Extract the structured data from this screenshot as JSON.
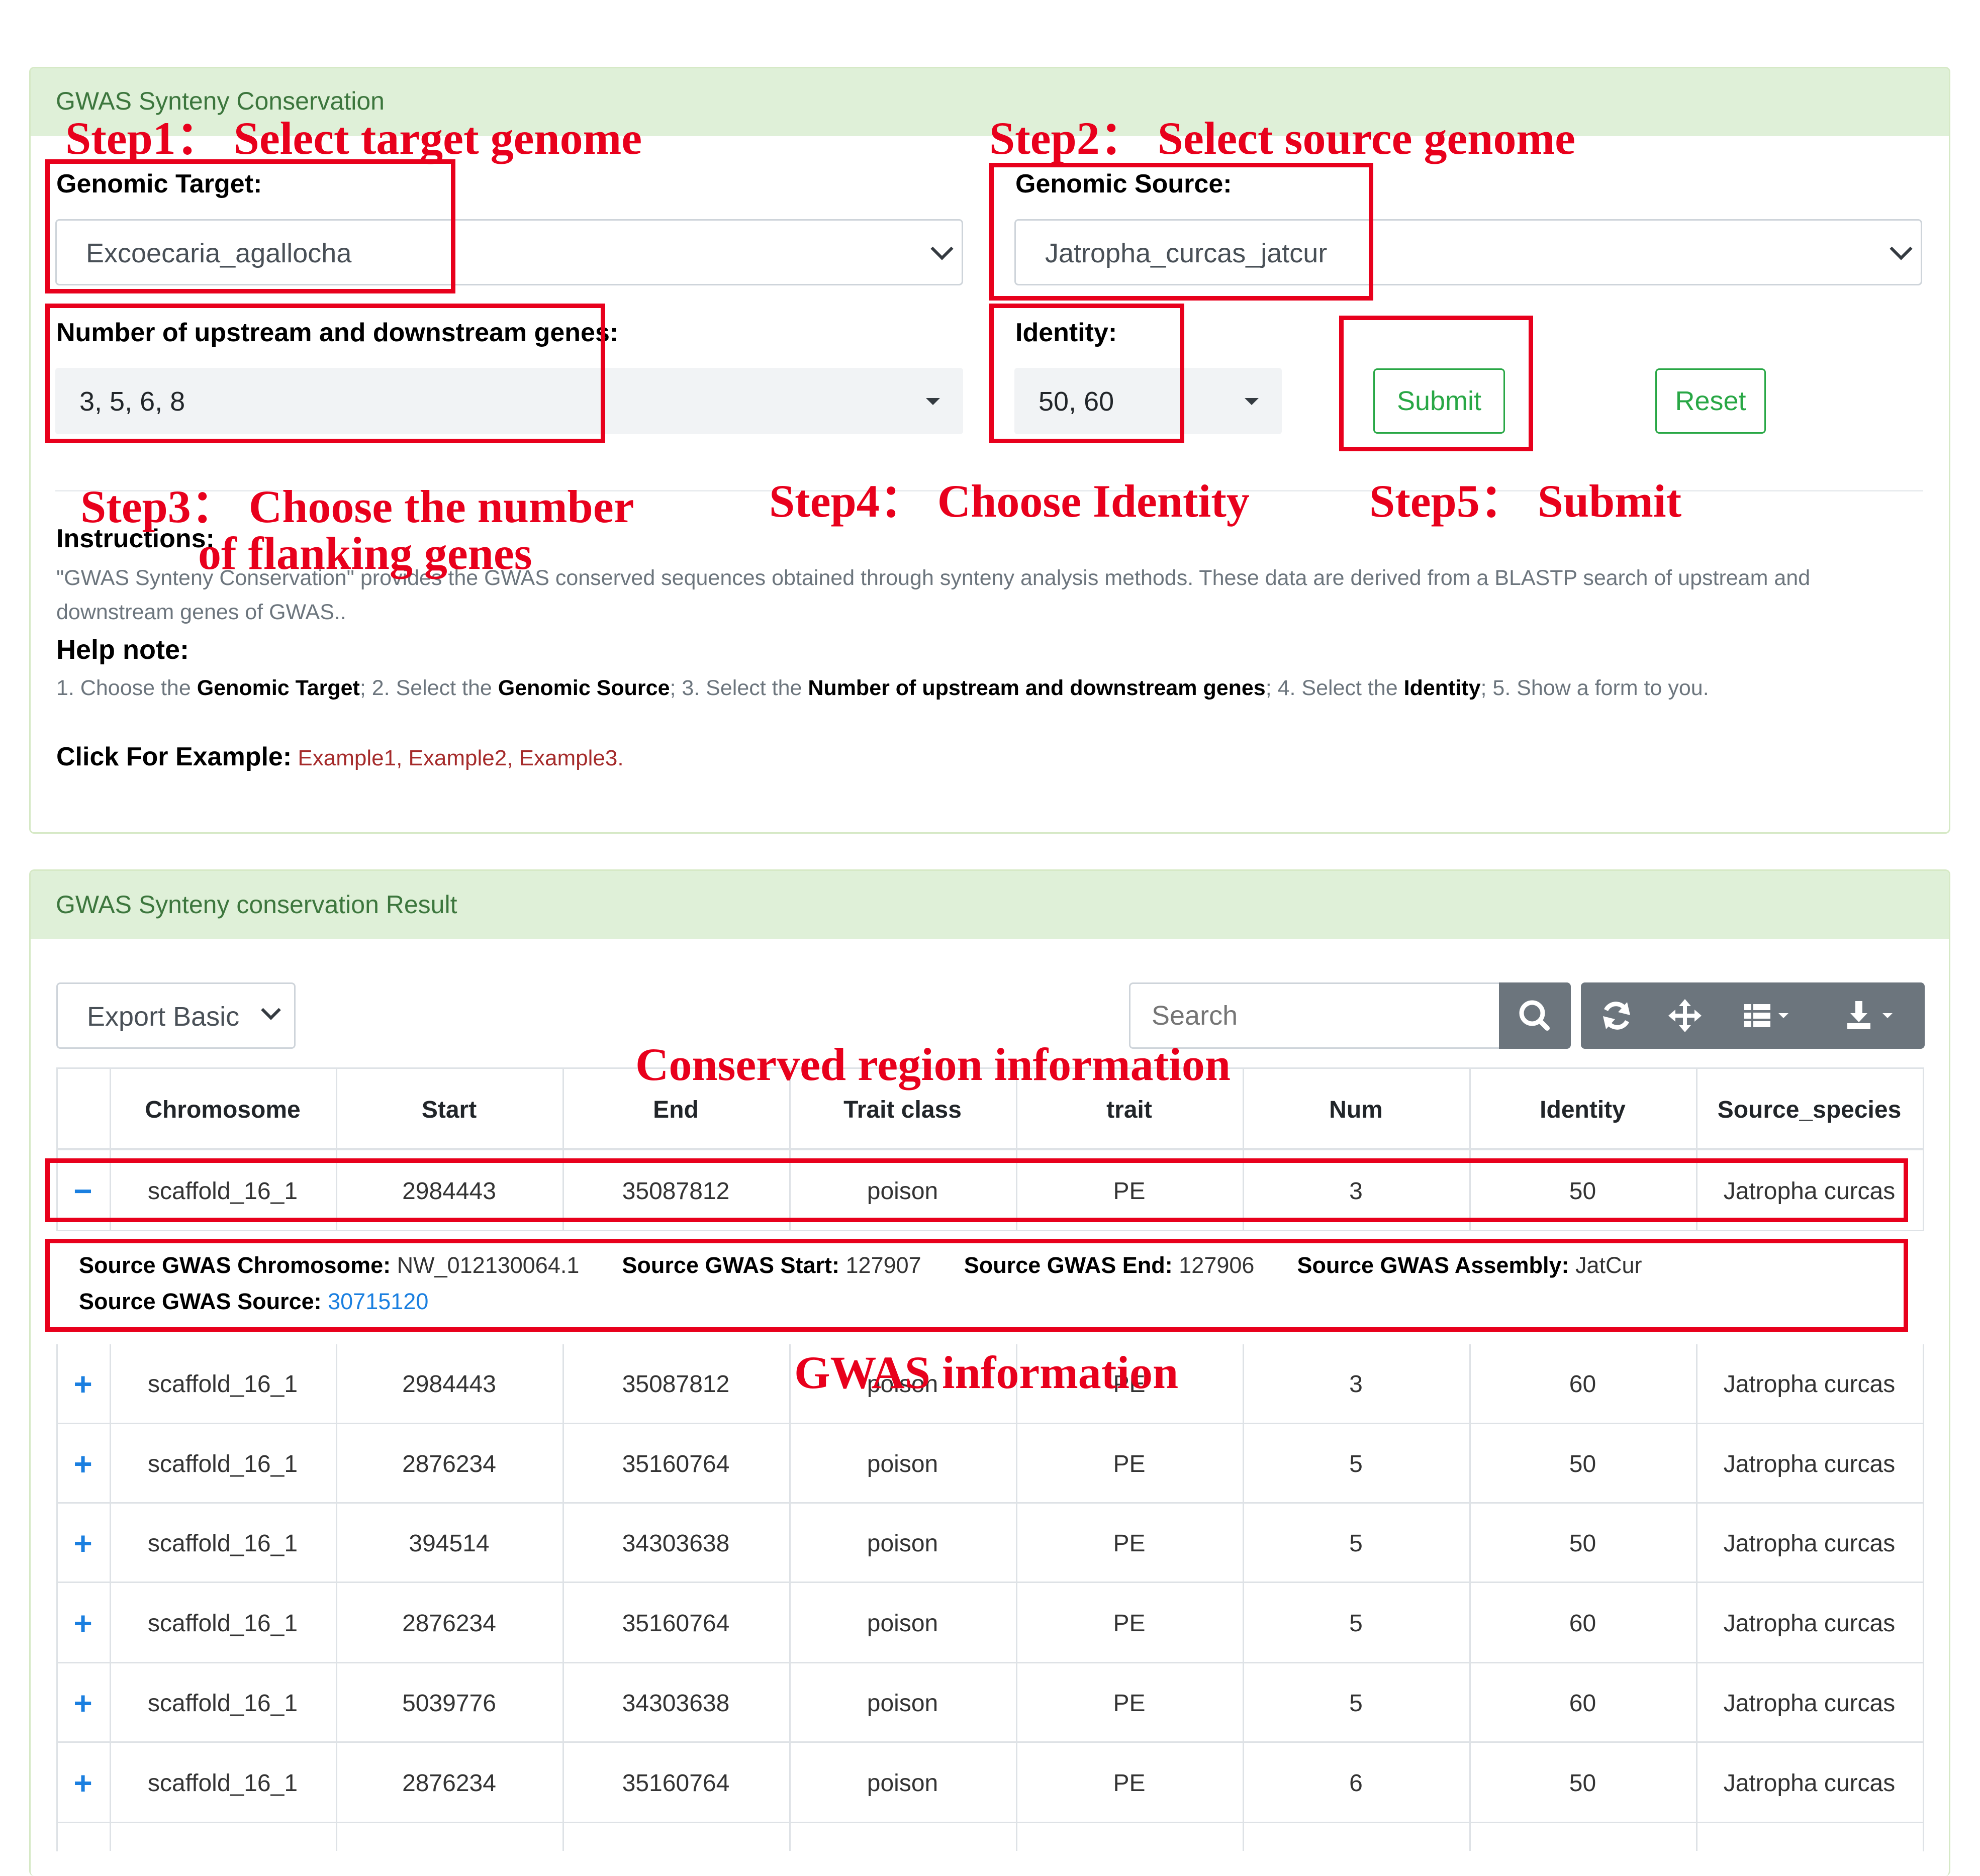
{
  "form_card": {
    "title": "GWAS Synteny Conservation",
    "genomic_target": {
      "label": "Genomic Target:",
      "value": "Excoecaria_agallocha"
    },
    "genomic_source": {
      "label": "Genomic Source:",
      "value": "Jatropha_curcas_jatcur"
    },
    "flanking": {
      "label": "Number of upstream and downstream genes:",
      "value": "3, 5, 6, 8"
    },
    "identity": {
      "label": "Identity:",
      "value": "50, 60"
    },
    "submit_label": "Submit",
    "reset_label": "Reset",
    "instructions_title": "Instructions:",
    "instructions_text_1": "\"GWAS Synteny Conservation\" provides the GWAS conserved sequences obtained through synteny analysis methods. These data are derived from a BLASTP search of upstream and",
    "instructions_text_2": "downstream genes of GWAS..",
    "help_title": "Help note:",
    "help_parts": [
      "1. Choose the ",
      "Genomic Target",
      "; 2. Select the ",
      "Genomic Source",
      "; 3. Select the ",
      "Number of upstream and downstream genes",
      "; 4. Select the ",
      "Identity",
      "; 5. Show a form to you."
    ],
    "example_label": "Click For Example:",
    "examples": [
      "Example1",
      "Example2",
      "Example3"
    ],
    "example_sep": ", ",
    "example_end": "."
  },
  "annotations": {
    "step1": "Step1： Select target genome",
    "step2": "Step2： Select source genome",
    "step3_line1": "Step3： Choose the number",
    "step3_line2": "of flanking genes",
    "step4": "Step4： Choose Identity",
    "step5": "Step5： Submit",
    "conserved": "Conserved region information",
    "gwas": "GWAS information"
  },
  "result_card": {
    "title": "GWAS Synteny conservation Result",
    "export_value": "Export Basic",
    "search_placeholder": "Search",
    "toolbar_icons": [
      "search-icon",
      "refresh-icon",
      "move-icon",
      "columns-icon",
      "download-icon"
    ],
    "columns": [
      "Chromosome",
      "Start",
      "End",
      "Trait class",
      "trait",
      "Num",
      "Identity",
      "Source_species"
    ],
    "rows": [
      {
        "toggle": "−",
        "chromosome": "scaffold_16_1",
        "start": "2984443",
        "end": "35087812",
        "trait_class": "poison",
        "trait": "PE",
        "num": "3",
        "identity": "50",
        "species": "Jatropha curcas"
      },
      {
        "toggle": "+",
        "chromosome": "scaffold_16_1",
        "start": "2984443",
        "end": "35087812",
        "trait_class": "poison",
        "trait": "PE",
        "num": "3",
        "identity": "60",
        "species": "Jatropha curcas"
      },
      {
        "toggle": "+",
        "chromosome": "scaffold_16_1",
        "start": "2876234",
        "end": "35160764",
        "trait_class": "poison",
        "trait": "PE",
        "num": "5",
        "identity": "50",
        "species": "Jatropha curcas"
      },
      {
        "toggle": "+",
        "chromosome": "scaffold_16_1",
        "start": "394514",
        "end": "34303638",
        "trait_class": "poison",
        "trait": "PE",
        "num": "5",
        "identity": "50",
        "species": "Jatropha curcas"
      },
      {
        "toggle": "+",
        "chromosome": "scaffold_16_1",
        "start": "2876234",
        "end": "35160764",
        "trait_class": "poison",
        "trait": "PE",
        "num": "5",
        "identity": "60",
        "species": "Jatropha curcas"
      },
      {
        "toggle": "+",
        "chromosome": "scaffold_16_1",
        "start": "5039776",
        "end": "34303638",
        "trait_class": "poison",
        "trait": "PE",
        "num": "5",
        "identity": "60",
        "species": "Jatropha curcas"
      },
      {
        "toggle": "+",
        "chromosome": "scaffold_16_1",
        "start": "2876234",
        "end": "35160764",
        "trait_class": "poison",
        "trait": "PE",
        "num": "6",
        "identity": "50",
        "species": "Jatropha curcas"
      }
    ],
    "detail": {
      "chrom_label": "Source GWAS Chromosome:",
      "chrom_value": "NW_012130064.1",
      "start_label": "Source GWAS Start:",
      "start_value": "127907",
      "end_label": "Source GWAS End:",
      "end_value": "127906",
      "assembly_label": "Source GWAS Assembly:",
      "assembly_value": "JatCur",
      "source_label": "Source GWAS Source:",
      "source_value": "30715120"
    }
  },
  "colors": {
    "accent_green": "#28a745",
    "header_green": "#dff0d8",
    "annotation_red": "#e8001c",
    "link_blue": "#1a7fe0",
    "toolbar_gray": "#6c757d"
  }
}
